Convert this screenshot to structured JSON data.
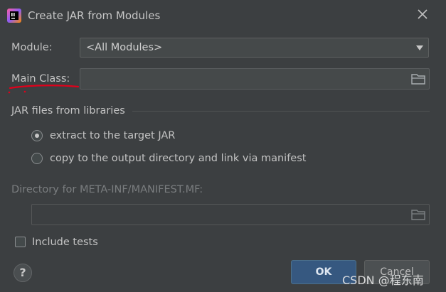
{
  "window": {
    "title": "Create JAR from Modules",
    "app_icon": "intellij-icon",
    "close_icon": "close-icon"
  },
  "module": {
    "label": "Module:",
    "value": "<All Modules>"
  },
  "main_class": {
    "label": "Main Class:",
    "value": ""
  },
  "jar_section": {
    "title": "JAR files from libraries",
    "options": [
      {
        "label": "extract to the target JAR",
        "selected": true
      },
      {
        "label": "copy to the output directory and link via manifest",
        "selected": false
      }
    ]
  },
  "manifest": {
    "label": "Directory for META-INF/MANIFEST.MF:",
    "value": ""
  },
  "include_tests": {
    "label": "Include tests",
    "checked": false
  },
  "buttons": {
    "help": "?",
    "ok": "OK",
    "cancel": "Cancel"
  },
  "watermark": "CSDN @程东南",
  "colors": {
    "background": "#3c3f41",
    "ok_button": "#365880",
    "annotation": "#e0001b"
  }
}
